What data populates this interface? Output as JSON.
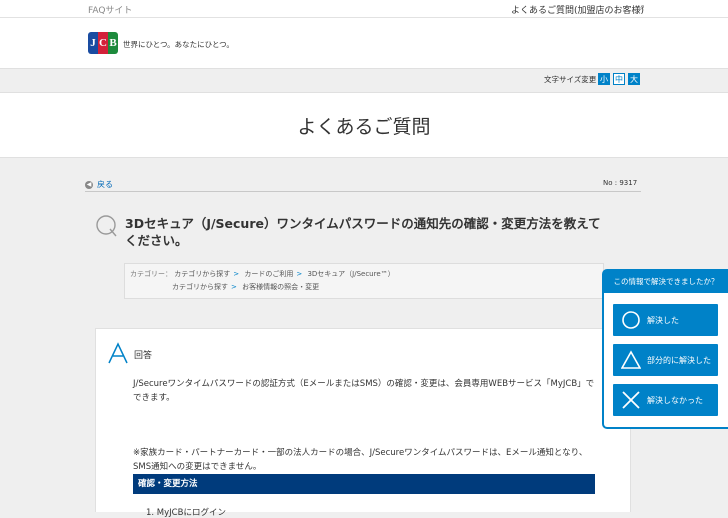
{
  "header": {
    "site_label": "FAQサイト",
    "top_link": "よくあるご質問(加盟店のお客様)",
    "logo_letters": [
      "J",
      "C",
      "B"
    ],
    "tagline": "世界にひとつ。あなたにひとつ。"
  },
  "font_size": {
    "label": "文字サイズ変更",
    "small": "小",
    "medium": "中",
    "large": "大"
  },
  "page_title": "よくあるご質問",
  "nav": {
    "back": "戻る",
    "faq_number": "No : 9317"
  },
  "question": {
    "title": "3Dセキュア（J/Secure）ワンタイムパスワードの通知先の確認・変更方法を教えてください。"
  },
  "categories": {
    "label": "カテゴリー：",
    "paths": [
      [
        "カテゴリから探す",
        "カードのご利用",
        "3Dセキュア（J/Secure™）"
      ],
      [
        "カテゴリから探す",
        "お客様情報の照会・変更"
      ]
    ]
  },
  "answer": {
    "label": "回答",
    "paragraph1": "J/Secureワンタイムパスワードの認証方式（EメールまたはSMS）の確認・変更は、会員専用WEBサービス「MyJCB」でできます。",
    "paragraph2": "※家族カード・パートナーカード・一部の法人カードの場合、J/Secureワンタイムパスワードは、Eメール通知となり、SMS通知への変更はできません。",
    "section_header": "確認・変更方法",
    "step1": "1. MyJCBにログイン"
  },
  "feedback": {
    "heading": "この情報で解決できましたか？",
    "options": [
      {
        "label": "解決した",
        "icon": "circle-icon"
      },
      {
        "label": "部分的に解決した",
        "icon": "triangle-icon"
      },
      {
        "label": "解決しなかった",
        "icon": "cross-icon"
      }
    ]
  },
  "colors": {
    "accent": "#0082c8",
    "navy": "#003b7c",
    "jcb_blue": "#1a4ca1",
    "jcb_red": "#d3213a",
    "jcb_green": "#1d8a3c"
  }
}
